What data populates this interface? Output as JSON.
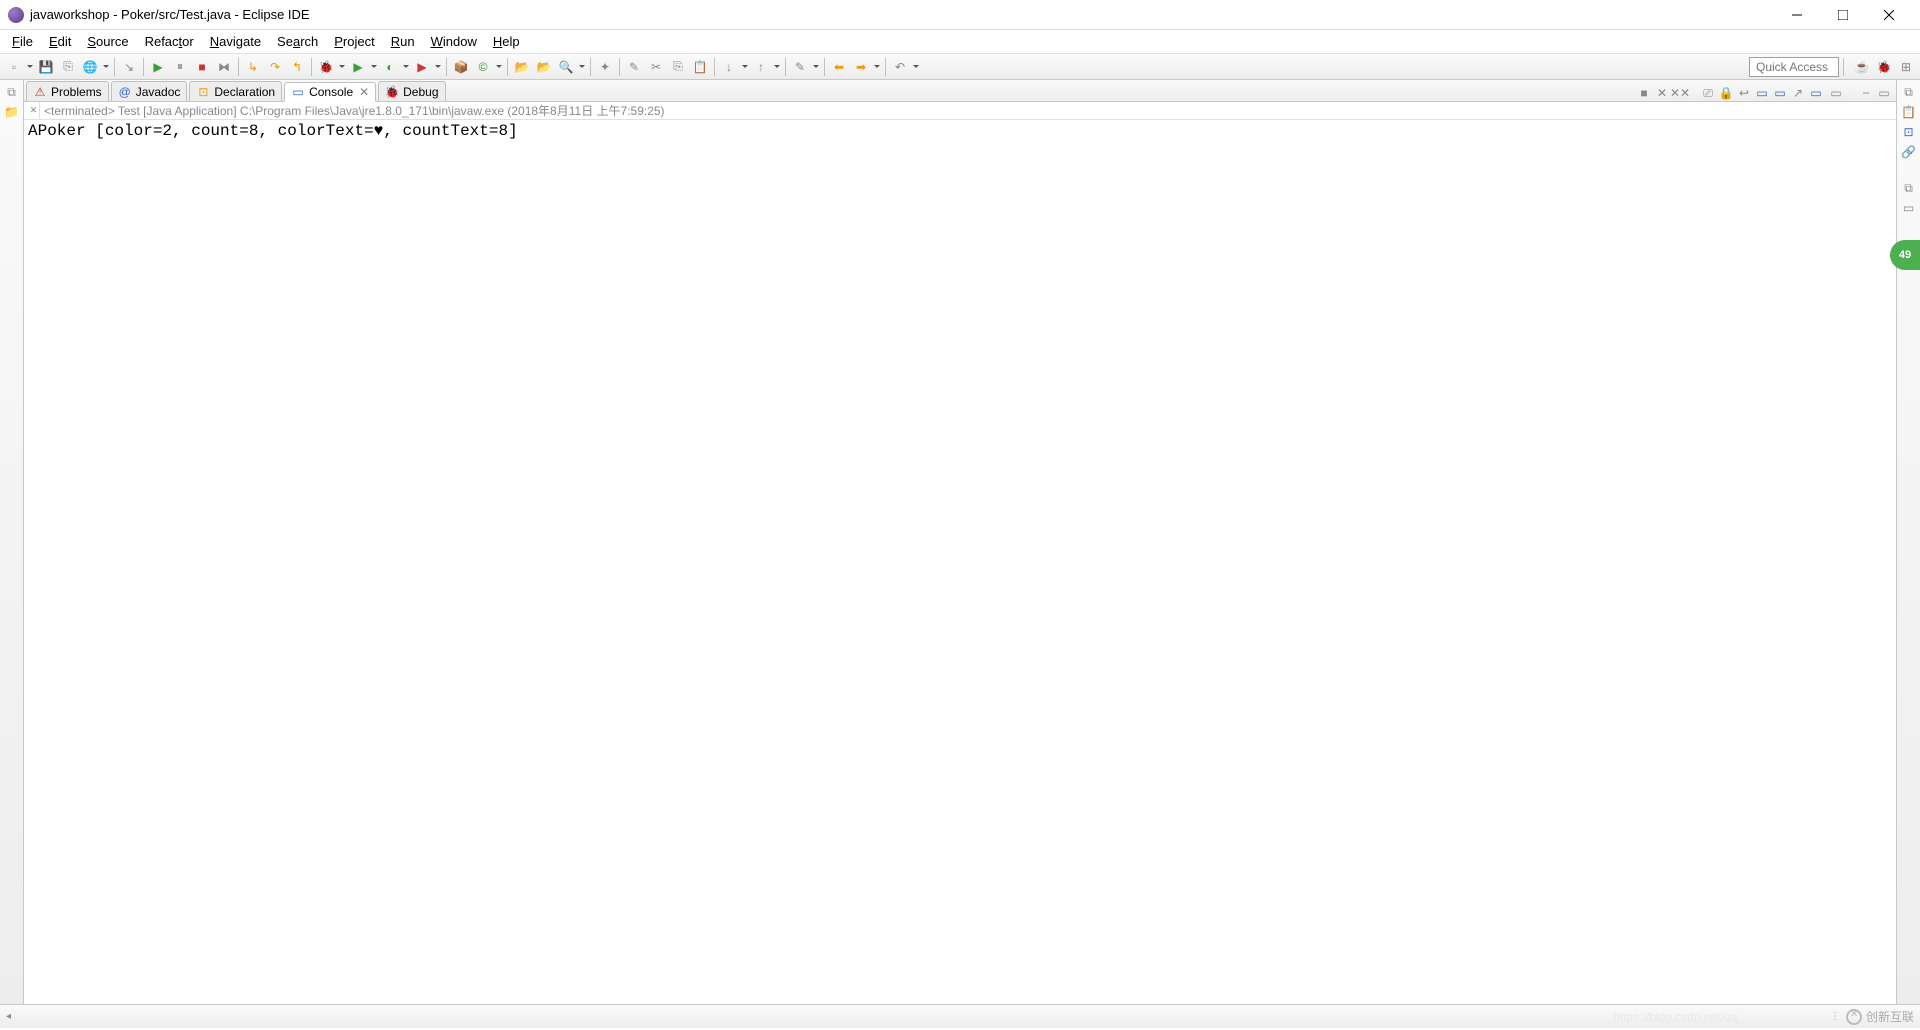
{
  "window": {
    "title": "javaworkshop - Poker/src/Test.java - Eclipse IDE"
  },
  "menubar": {
    "items": [
      "File",
      "Edit",
      "Source",
      "Refactor",
      "Navigate",
      "Search",
      "Project",
      "Run",
      "Window",
      "Help"
    ]
  },
  "toolbar": {
    "quick_access": "Quick Access"
  },
  "views": {
    "tabs": [
      {
        "label": "Problems"
      },
      {
        "label": "Javadoc"
      },
      {
        "label": "Declaration"
      },
      {
        "label": "Console",
        "active": true
      },
      {
        "label": "Debug"
      }
    ]
  },
  "console": {
    "header": "<terminated> Test [Java Application] C:\\Program Files\\Java\\jre1.8.0_171\\bin\\javaw.exe (2018年8月11日 上午7:59:25)",
    "output": "APoker [color=2, count=8, colorText=♥, countText=8]"
  },
  "statusbar": {
    "watermark": "https://blog.csdn.net/qq_",
    "brand": "创新互联"
  },
  "badge": {
    "value": "49"
  }
}
